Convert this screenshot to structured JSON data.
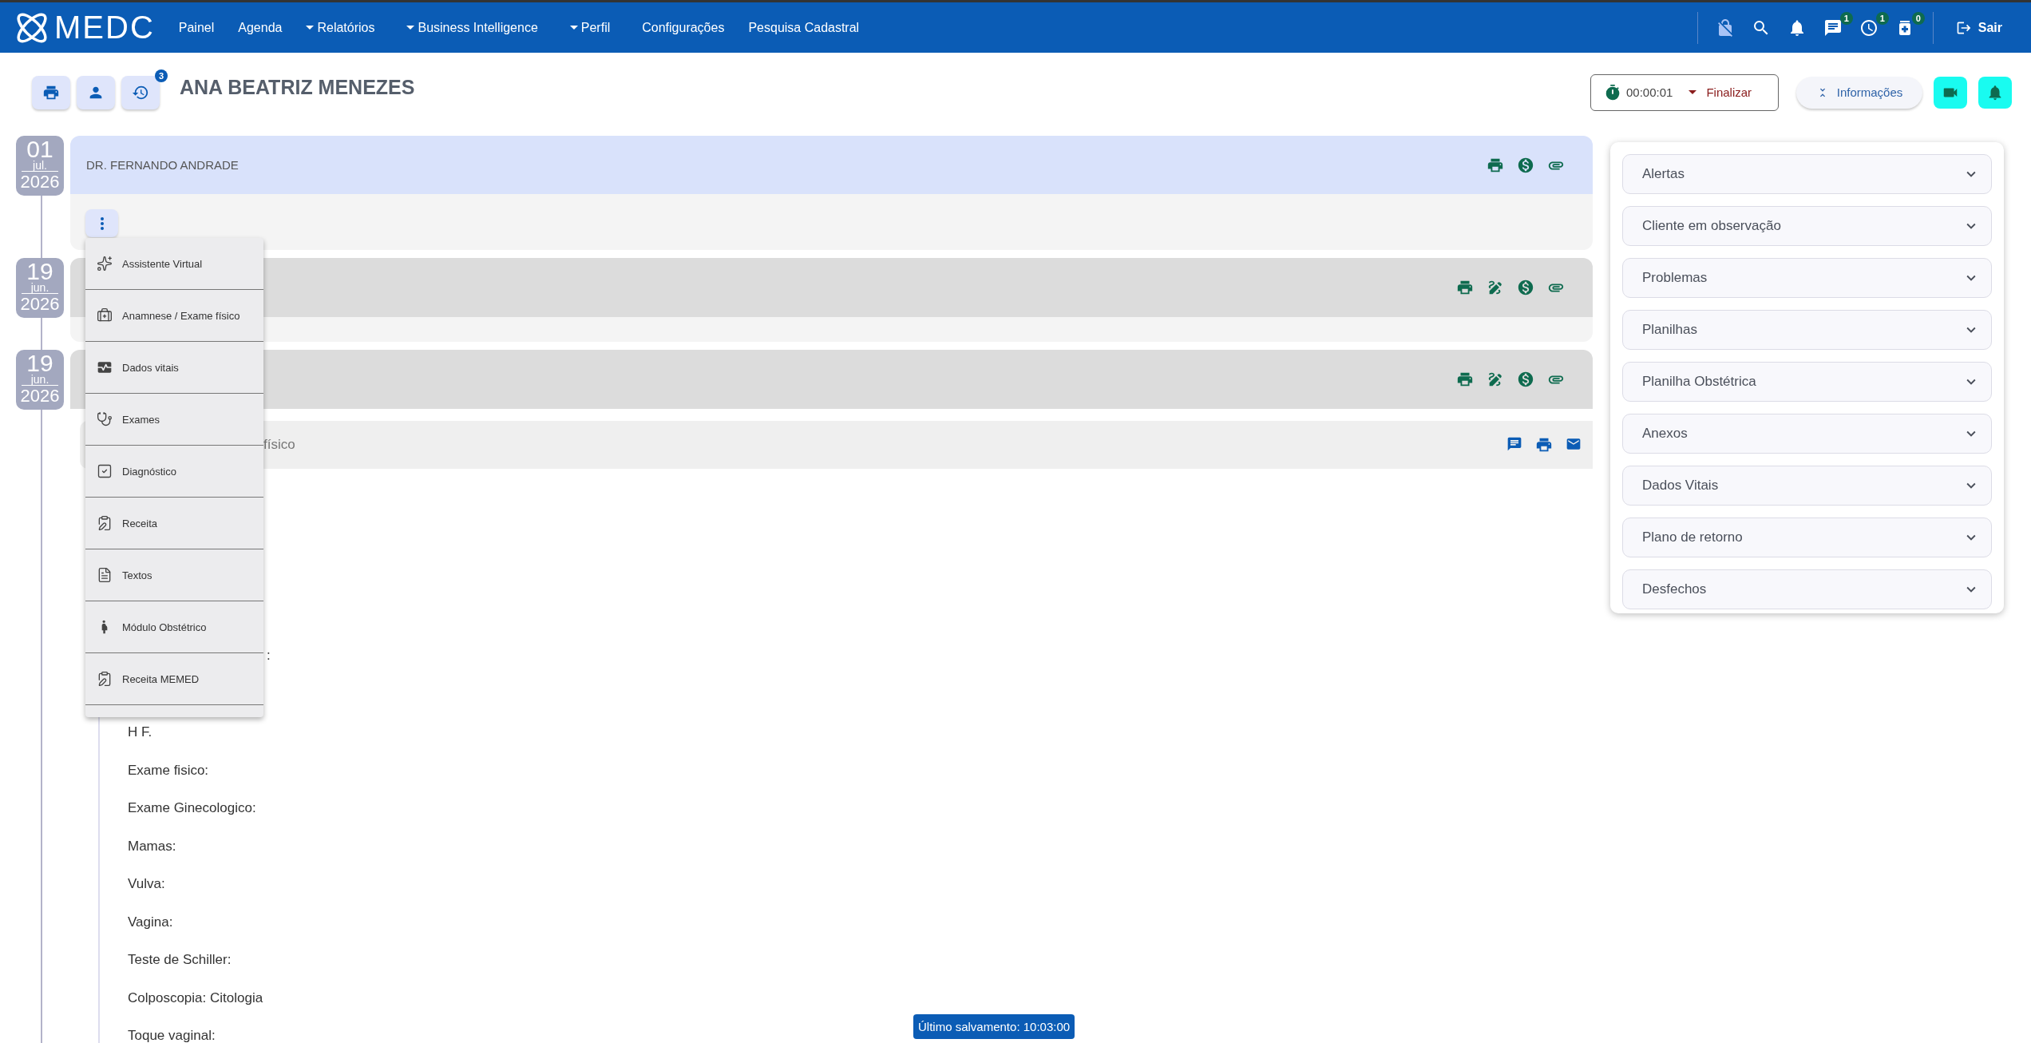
{
  "nav": {
    "logo": "MEDC",
    "items": [
      {
        "label": "Painel",
        "dropdown": false
      },
      {
        "label": "Agenda",
        "dropdown": false
      },
      {
        "label": "Relatórios",
        "dropdown": true
      },
      {
        "label": "Business Intelligence",
        "dropdown": true
      },
      {
        "label": "Perfil",
        "dropdown": true
      },
      {
        "label": "Configurações",
        "dropdown": false
      },
      {
        "label": "Pesquisa Cadastral",
        "dropdown": false
      }
    ],
    "actions": [
      {
        "kind": "lock-off"
      },
      {
        "kind": "search"
      },
      {
        "kind": "bell"
      },
      {
        "kind": "chat",
        "badge": "1"
      },
      {
        "kind": "clock",
        "badge": "1"
      },
      {
        "kind": "medication",
        "badge": "0"
      }
    ],
    "logout": "Sair"
  },
  "header": {
    "tools": [
      {
        "kind": "print"
      },
      {
        "kind": "person"
      },
      {
        "kind": "history",
        "badge": "3"
      }
    ],
    "patient": "ANA BEATRIZ MENEZES",
    "timer": "00:00:01",
    "finish": "Finalizar",
    "info": "Informações",
    "buttons": [
      {
        "kind": "video"
      },
      {
        "kind": "bell"
      }
    ]
  },
  "timeline": [
    {
      "date": {
        "day": "01",
        "month": "jul.",
        "year": "2026"
      },
      "title": "DR. FERNANDO ANDRADE",
      "highlighted": true,
      "actions": [
        {
          "kind": "print"
        },
        {
          "kind": "money"
        },
        {
          "kind": "clip"
        }
      ]
    },
    {
      "date": {
        "day": "19",
        "month": "jun.",
        "year": "2026"
      },
      "highlighted": false,
      "actions": [
        {
          "kind": "print"
        },
        {
          "kind": "edit"
        },
        {
          "kind": "money"
        },
        {
          "kind": "clip"
        }
      ]
    },
    {
      "date": {
        "day": "19",
        "month": "jun.",
        "year": "2026"
      },
      "highlighted": false,
      "actions": [
        {
          "kind": "print"
        },
        {
          "kind": "edit"
        },
        {
          "kind": "money"
        },
        {
          "kind": "clip"
        }
      ],
      "section": {
        "title": "físico",
        "actions": [
          {
            "kind": "comment"
          },
          {
            "kind": "print"
          },
          {
            "kind": "mail"
          }
        ]
      },
      "content": [
        {
          "kind": "fragment",
          "text": ":"
        },
        {
          "kind": "line",
          "text": "H F."
        },
        {
          "kind": "line",
          "text": "Exame fisico:"
        },
        {
          "kind": "line",
          "text": "Exame Ginecologico:"
        },
        {
          "kind": "line",
          "text": "Mamas:"
        },
        {
          "kind": "line",
          "text": "Vulva:"
        },
        {
          "kind": "line",
          "text": "Vagina:"
        },
        {
          "kind": "line",
          "text": "Teste de Schiller:"
        },
        {
          "kind": "line",
          "text": "Colposcopia: Citologia"
        },
        {
          "kind": "line",
          "text": "Toque vaginal:"
        }
      ]
    }
  ],
  "menu": [
    {
      "kind": "sparkles",
      "label": "Assistente Virtual"
    },
    {
      "kind": "medkit",
      "label": "Anamnese / Exame físico"
    },
    {
      "kind": "vitals",
      "label": "Dados vitais"
    },
    {
      "kind": "stethoscope",
      "label": "Exames"
    },
    {
      "kind": "check",
      "label": "Diagnóstico"
    },
    {
      "kind": "prescription",
      "label": "Receita"
    },
    {
      "kind": "document",
      "label": "Textos"
    },
    {
      "kind": "pregnant",
      "label": "Módulo Obstétrico"
    },
    {
      "kind": "prescription",
      "label": "Receita MEMED"
    }
  ],
  "side_panel": [
    {
      "label": "Alertas"
    },
    {
      "label": "Cliente em observação"
    },
    {
      "label": "Problemas"
    },
    {
      "label": "Planilhas"
    },
    {
      "label": "Planilha Obstétrica"
    },
    {
      "label": "Anexos"
    },
    {
      "label": "Dados Vitais"
    },
    {
      "label": "Plano de retorno"
    },
    {
      "label": "Desfechos"
    }
  ],
  "status": "Último salvamento: 10:03:00"
}
